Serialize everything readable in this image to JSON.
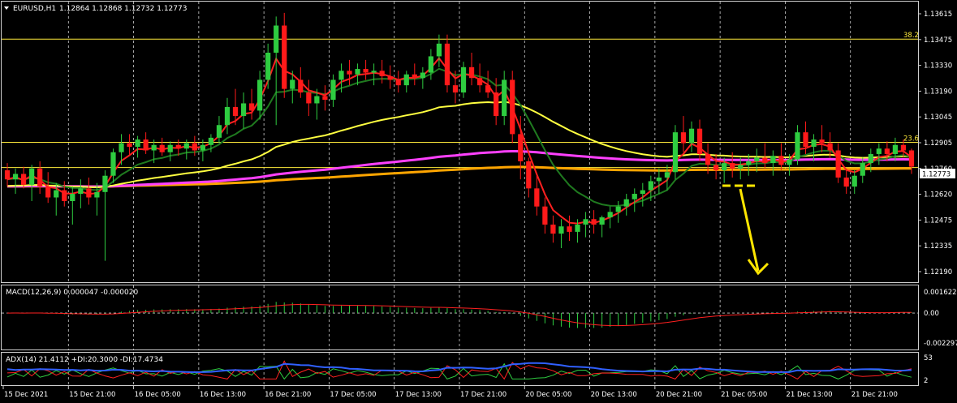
{
  "symbol_header": {
    "symbol": "EURUSD,H1",
    "ohlc": "1.12864 1.12868 1.12732 1.12773"
  },
  "current_price": "1.12773",
  "colors": {
    "background": "#000000",
    "grid": "#d0d0d0",
    "bull": "#2ecc40",
    "bear": "#ff1a1a",
    "ema_fast": "#ff2020",
    "ema_slow": "#1f7a1f",
    "sma_200": "#ffa500",
    "sma_100": "#ff40ff",
    "sma_50": "#ffff40",
    "fib_line": "#ffeb3b",
    "arrow": "#ffe600",
    "macd_hist": "#2ecc40",
    "macd_signal": "#ff2020",
    "adx_main": "#3060ff",
    "plus_di": "#2ecc40",
    "minus_di": "#ff2020"
  },
  "chart_data": [
    {
      "type": "candlestick",
      "title": "EURUSD,H1",
      "ylim": [
        1.1219,
        1.13615
      ],
      "y_ticks": [
        "1.13615",
        "1.13475",
        "1.13330",
        "1.13190",
        "1.13045",
        "1.12905",
        "1.12760",
        "1.12620",
        "1.12475",
        "1.12335",
        "1.12190"
      ],
      "x_ticks": [
        "15 Dec 2021",
        "15 Dec 21:00",
        "16 Dec 05:00",
        "16 Dec 13:00",
        "16 Dec 21:00",
        "17 Dec 05:00",
        "17 Dec 13:00",
        "17 Dec 21:00",
        "20 Dec 05:00",
        "20 Dec 13:00",
        "20 Dec 21:00",
        "21 Dec 05:00",
        "21 Dec 13:00",
        "21 Dec 21:00"
      ],
      "fib_levels": [
        {
          "label": "38.2",
          "price": 1.13475
        },
        {
          "label": "23.6",
          "price": 1.12905
        },
        {
          "label": "",
          "price": 1.12765
        }
      ],
      "grid": true,
      "candles": [
        [
          1.1275,
          1.1279,
          1.1266,
          1.127
        ],
        [
          1.127,
          1.1276,
          1.1262,
          1.1273
        ],
        [
          1.1273,
          1.1277,
          1.1265,
          1.1267
        ],
        [
          1.1267,
          1.1278,
          1.1258,
          1.1276
        ],
        [
          1.1276,
          1.128,
          1.1262,
          1.1266
        ],
        [
          1.1266,
          1.1274,
          1.1257,
          1.126
        ],
        [
          1.126,
          1.1268,
          1.125,
          1.1264
        ],
        [
          1.1264,
          1.1269,
          1.1255,
          1.1258
        ],
        [
          1.1258,
          1.1266,
          1.1245,
          1.1262
        ],
        [
          1.1262,
          1.127,
          1.1254,
          1.1265
        ],
        [
          1.1265,
          1.1271,
          1.1256,
          1.126
        ],
        [
          1.126,
          1.1268,
          1.125,
          1.1263
        ],
        [
          1.1263,
          1.1275,
          1.1225,
          1.1272
        ],
        [
          1.1272,
          1.1287,
          1.1268,
          1.1285
        ],
        [
          1.1285,
          1.1295,
          1.1278,
          1.129
        ],
        [
          1.129,
          1.1295,
          1.1283,
          1.1288
        ],
        [
          1.1288,
          1.1294,
          1.1282,
          1.1292
        ],
        [
          1.1292,
          1.1296,
          1.1284,
          1.1286
        ],
        [
          1.1286,
          1.1292,
          1.1279,
          1.1289
        ],
        [
          1.1289,
          1.1293,
          1.1283,
          1.1285
        ],
        [
          1.1285,
          1.1291,
          1.128,
          1.1289
        ],
        [
          1.1289,
          1.1292,
          1.1283,
          1.1287
        ],
        [
          1.1287,
          1.1292,
          1.1281,
          1.129
        ],
        [
          1.129,
          1.1294,
          1.1283,
          1.1286
        ],
        [
          1.1286,
          1.1292,
          1.128,
          1.1289
        ],
        [
          1.1289,
          1.1295,
          1.1285,
          1.1293
        ],
        [
          1.1293,
          1.1305,
          1.129,
          1.13
        ],
        [
          1.13,
          1.1315,
          1.1295,
          1.131
        ],
        [
          1.131,
          1.132,
          1.13,
          1.1305
        ],
        [
          1.1305,
          1.1318,
          1.1298,
          1.1312
        ],
        [
          1.1312,
          1.132,
          1.1303,
          1.1308
        ],
        [
          1.1308,
          1.133,
          1.1303,
          1.1325
        ],
        [
          1.1325,
          1.1345,
          1.132,
          1.134
        ],
        [
          1.134,
          1.136,
          1.13,
          1.1355
        ],
        [
          1.1355,
          1.1362,
          1.1315,
          1.132
        ],
        [
          1.132,
          1.133,
          1.1312,
          1.1325
        ],
        [
          1.1325,
          1.1332,
          1.1315,
          1.1318
        ],
        [
          1.1318,
          1.1325,
          1.1305,
          1.1312
        ],
        [
          1.1312,
          1.132,
          1.1303,
          1.1316
        ],
        [
          1.1316,
          1.1322,
          1.1308,
          1.1314
        ],
        [
          1.1314,
          1.1328,
          1.131,
          1.1325
        ],
        [
          1.1325,
          1.1334,
          1.1318,
          1.133
        ],
        [
          1.133,
          1.1336,
          1.1322,
          1.1328
        ],
        [
          1.1328,
          1.1334,
          1.1322,
          1.1331
        ],
        [
          1.1331,
          1.1336,
          1.1325,
          1.1329
        ],
        [
          1.1329,
          1.1334,
          1.1322,
          1.133
        ],
        [
          1.133,
          1.1336,
          1.1323,
          1.1327
        ],
        [
          1.1327,
          1.1333,
          1.132,
          1.1325
        ],
        [
          1.1325,
          1.133,
          1.1318,
          1.1322
        ],
        [
          1.1322,
          1.133,
          1.1318,
          1.1328
        ],
        [
          1.1328,
          1.1334,
          1.1322,
          1.1326
        ],
        [
          1.1326,
          1.1332,
          1.132,
          1.1329
        ],
        [
          1.1329,
          1.1342,
          1.1325,
          1.1338
        ],
        [
          1.1338,
          1.135,
          1.1332,
          1.1345
        ],
        [
          1.1345,
          1.135,
          1.1318,
          1.1322
        ],
        [
          1.1322,
          1.133,
          1.1312,
          1.1318
        ],
        [
          1.1318,
          1.1335,
          1.1315,
          1.1332
        ],
        [
          1.1332,
          1.134,
          1.1322,
          1.1326
        ],
        [
          1.1326,
          1.1334,
          1.1318,
          1.1322
        ],
        [
          1.1322,
          1.133,
          1.1315,
          1.1318
        ],
        [
          1.1318,
          1.1326,
          1.13,
          1.1305
        ],
        [
          1.1305,
          1.133,
          1.13,
          1.1325
        ],
        [
          1.1325,
          1.133,
          1.129,
          1.1295
        ],
        [
          1.1295,
          1.1305,
          1.127,
          1.128
        ],
        [
          1.128,
          1.1282,
          1.126,
          1.1265
        ],
        [
          1.1265,
          1.1272,
          1.125,
          1.1255
        ],
        [
          1.1255,
          1.126,
          1.124,
          1.1245
        ],
        [
          1.1245,
          1.125,
          1.1235,
          1.124
        ],
        [
          1.124,
          1.1248,
          1.1232,
          1.1244
        ],
        [
          1.1244,
          1.125,
          1.1236,
          1.1241
        ],
        [
          1.1241,
          1.1248,
          1.1235,
          1.1245
        ],
        [
          1.1245,
          1.1252,
          1.1238,
          1.1248
        ],
        [
          1.1248,
          1.1253,
          1.124,
          1.1245
        ],
        [
          1.1245,
          1.125,
          1.1238,
          1.1249
        ],
        [
          1.1249,
          1.1255,
          1.1243,
          1.1252
        ],
        [
          1.1252,
          1.1258,
          1.1246,
          1.1255
        ],
        [
          1.1255,
          1.1262,
          1.125,
          1.1259
        ],
        [
          1.1259,
          1.1265,
          1.1252,
          1.1262
        ],
        [
          1.1262,
          1.1268,
          1.1255,
          1.1264
        ],
        [
          1.1264,
          1.1272,
          1.1258,
          1.1269
        ],
        [
          1.1269,
          1.1276,
          1.1262,
          1.1271
        ],
        [
          1.1271,
          1.1278,
          1.1264,
          1.1274
        ],
        [
          1.1274,
          1.13,
          1.127,
          1.1296
        ],
        [
          1.1296,
          1.1305,
          1.1285,
          1.129
        ],
        [
          1.129,
          1.1302,
          1.1285,
          1.1298
        ],
        [
          1.1298,
          1.1303,
          1.128,
          1.1284
        ],
        [
          1.1284,
          1.129,
          1.1273,
          1.1278
        ],
        [
          1.1278,
          1.1284,
          1.127,
          1.1275
        ],
        [
          1.1275,
          1.1282,
          1.1268,
          1.1279
        ],
        [
          1.1279,
          1.1285,
          1.1271,
          1.1276
        ],
        [
          1.1276,
          1.1282,
          1.127,
          1.1278
        ],
        [
          1.1278,
          1.1284,
          1.1272,
          1.128
        ],
        [
          1.128,
          1.1287,
          1.1274,
          1.1282
        ],
        [
          1.1282,
          1.129,
          1.1276,
          1.1279
        ],
        [
          1.1279,
          1.1286,
          1.1272,
          1.1283
        ],
        [
          1.1283,
          1.129,
          1.1275,
          1.1278
        ],
        [
          1.1278,
          1.1284,
          1.1272,
          1.1281
        ],
        [
          1.1281,
          1.13,
          1.1278,
          1.1296
        ],
        [
          1.1296,
          1.1302,
          1.1284,
          1.1288
        ],
        [
          1.1288,
          1.1295,
          1.128,
          1.1292
        ],
        [
          1.1292,
          1.13,
          1.1285,
          1.129
        ],
        [
          1.129,
          1.1296,
          1.1282,
          1.1286
        ],
        [
          1.1286,
          1.129,
          1.1268,
          1.1271
        ],
        [
          1.1271,
          1.1276,
          1.1262,
          1.1266
        ],
        [
          1.1266,
          1.1275,
          1.1262,
          1.1272
        ],
        [
          1.1272,
          1.1282,
          1.1268,
          1.1279
        ],
        [
          1.1279,
          1.1287,
          1.1274,
          1.1284
        ],
        [
          1.1284,
          1.129,
          1.1278,
          1.1287
        ],
        [
          1.1287,
          1.1291,
          1.128,
          1.1284
        ],
        [
          1.1284,
          1.1293,
          1.128,
          1.1289
        ],
        [
          1.1289,
          1.1292,
          1.1282,
          1.1286
        ],
        [
          1.1286,
          1.1287,
          1.1273,
          1.1277
        ]
      ],
      "indicators": {
        "ema_fast_period": 8,
        "ema_slow_period": 21,
        "sma_periods": [
          50,
          100,
          200
        ]
      }
    },
    {
      "type": "histogram",
      "title": "MACD(12,26,9) 0.000047 -0.000020",
      "ylim": [
        -0.002297,
        0.001622
      ],
      "y_ticks": [
        "0.001622",
        "0.00",
        "-0.002297"
      ],
      "series": [
        {
          "name": "MACD",
          "role": "histogram"
        },
        {
          "name": "Signal",
          "role": "line"
        }
      ]
    },
    {
      "type": "line",
      "title": "ADX(14) 21.4112 +DI:20.3000 -DI:17.4734",
      "ylim": [
        2,
        53
      ],
      "y_ticks": [
        "53",
        "2"
      ],
      "series": [
        {
          "name": "ADX",
          "role": "line"
        },
        {
          "name": "+DI",
          "role": "line"
        },
        {
          "name": "-DI",
          "role": "line"
        }
      ]
    }
  ]
}
